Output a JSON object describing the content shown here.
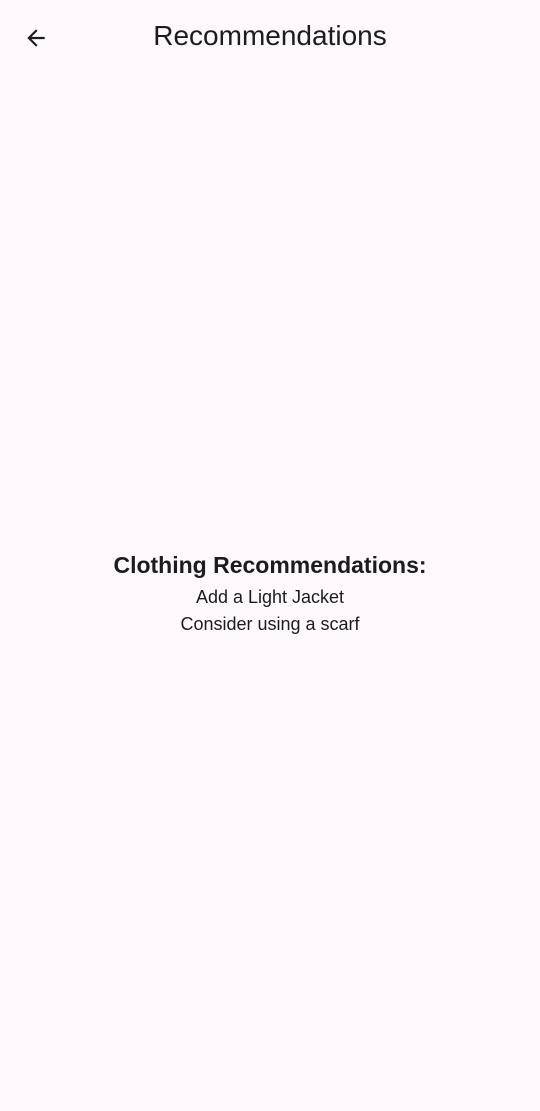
{
  "app_bar": {
    "back_icon": "arrow-back-icon",
    "title": "Recommendations"
  },
  "main": {
    "heading": "Clothing Recommendations:",
    "items": [
      "Add a Light Jacket",
      "Consider using a scarf"
    ]
  },
  "colors": {
    "background": "#fdf8fb",
    "text": "#1d1b20"
  }
}
